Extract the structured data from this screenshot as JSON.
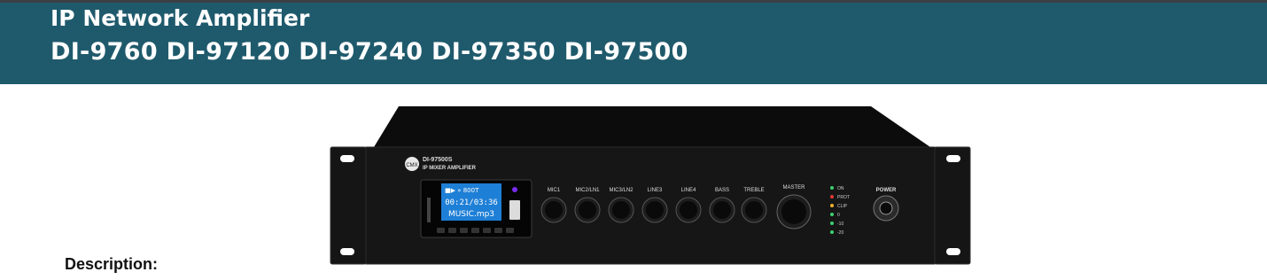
{
  "header": {
    "title": "IP Network Amplifier",
    "models": "DI-9760 DI-97120 DI-97240 DI-97350 DI-97500"
  },
  "section": {
    "description_label": "Description:"
  },
  "product": {
    "brand": "CMX",
    "model": "DI-97500S",
    "subtitle": "IP MIXER AMPLIFIER",
    "display_time": "00:21/03:36",
    "display_file": "MUSIC.mp3",
    "display_top": "■▶ » 800T",
    "knobs": [
      "MIC1",
      "MIC2/LN1",
      "MIC3/LN2",
      "LINE3",
      "LINE4",
      "BASS",
      "TREBLE"
    ],
    "master_label": "MASTER",
    "indicators": [
      "ON",
      "PROT",
      "CLIP",
      "0",
      "-10",
      "-20"
    ],
    "power_label": "POWER"
  },
  "colors": {
    "header_bg": "#1f5a6c",
    "chassis": "#111111"
  }
}
